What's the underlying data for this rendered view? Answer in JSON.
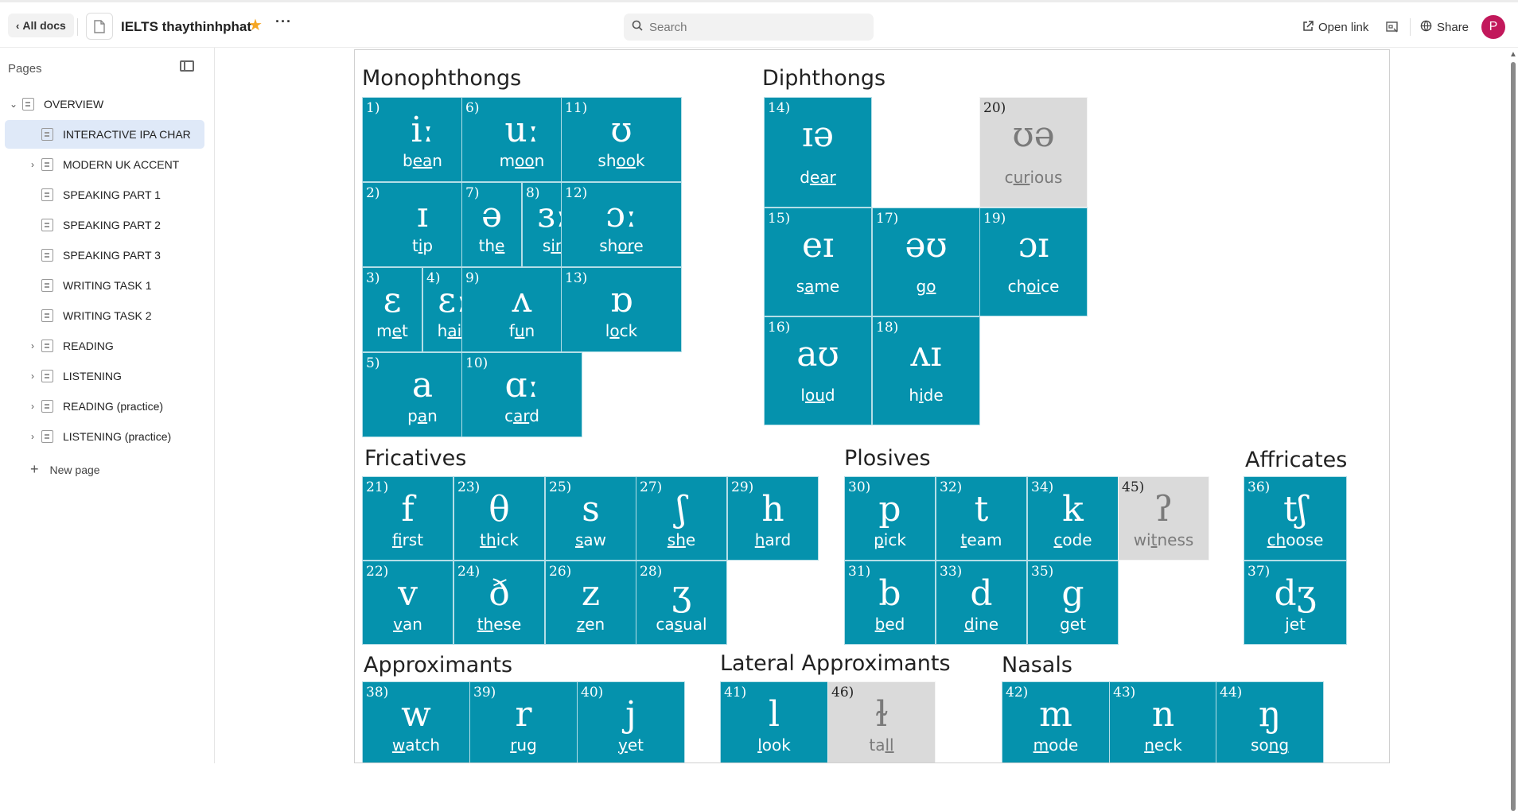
{
  "topbar": {
    "all_docs": "All docs",
    "doc_title": "IELTS thaythinhphat",
    "search_placeholder": "Search",
    "open_link": "Open link",
    "share": "Share",
    "avatar_letter": "P"
  },
  "sidebar": {
    "pages_label": "Pages",
    "items": [
      {
        "label": "OVERVIEW",
        "expand": "v",
        "indent": 0
      },
      {
        "label": "INTERACTIVE IPA CHAR",
        "expand": "",
        "indent": 1,
        "selected": true
      },
      {
        "label": "MODERN UK ACCENT",
        "expand": ">",
        "indent": 1
      },
      {
        "label": "SPEAKING PART 1",
        "expand": "",
        "indent": 1
      },
      {
        "label": "SPEAKING PART 2",
        "expand": "",
        "indent": 1
      },
      {
        "label": "SPEAKING PART 3",
        "expand": "",
        "indent": 1
      },
      {
        "label": "WRITING TASK 1",
        "expand": "",
        "indent": 1
      },
      {
        "label": "WRITING TASK 2",
        "expand": "",
        "indent": 1
      },
      {
        "label": "READING",
        "expand": ">",
        "indent": 1
      },
      {
        "label": "LISTENING",
        "expand": ">",
        "indent": 1
      },
      {
        "label": "READING (practice)",
        "expand": ">",
        "indent": 1
      },
      {
        "label": "LISTENING (practice)",
        "expand": ">",
        "indent": 1
      }
    ],
    "new_page": "New page"
  },
  "chart": {
    "sections": {
      "monophthongs": "Monophthongs",
      "diphthongs": "Diphthongs",
      "fricatives": "Fricatives",
      "plosives": "Plosives",
      "affricates": "Affricates",
      "approximants": "Approximants",
      "lateral": "Lateral Approximants",
      "nasals": "Nasals"
    },
    "sounds": [
      {
        "n": "1)",
        "sym": "iː",
        "word": [
          "b",
          "ea",
          "n"
        ]
      },
      {
        "n": "6)",
        "sym": "uː",
        "word": [
          "m",
          "oo",
          "n"
        ]
      },
      {
        "n": "11)",
        "sym": "ʊ",
        "word": [
          "sh",
          "oo",
          "k"
        ]
      },
      {
        "n": "2)",
        "sym": "ɪ",
        "word": [
          "t",
          "i",
          "p"
        ]
      },
      {
        "n": "7)",
        "sym": "ə",
        "word": [
          "th",
          "e",
          ""
        ]
      },
      {
        "n": "8)",
        "sym": "ɜː",
        "word": [
          "s",
          "ir",
          ""
        ]
      },
      {
        "n": "12)",
        "sym": "ɔː",
        "word": [
          "sh",
          "or",
          "e"
        ]
      },
      {
        "n": "3)",
        "sym": "ɛ",
        "word": [
          "m",
          "e",
          "t"
        ]
      },
      {
        "n": "4)",
        "sym": "ɛː",
        "word": [
          "h",
          "air",
          ""
        ]
      },
      {
        "n": "9)",
        "sym": "ʌ",
        "word": [
          "f",
          "u",
          "n"
        ]
      },
      {
        "n": "13)",
        "sym": "ɒ",
        "word": [
          "l",
          "o",
          "ck"
        ]
      },
      {
        "n": "5)",
        "sym": "a",
        "word": [
          "p",
          "a",
          "n"
        ]
      },
      {
        "n": "10)",
        "sym": "ɑː",
        "word": [
          "c",
          "ar",
          "d"
        ]
      },
      {
        "n": "14)",
        "sym": "ɪə",
        "word": [
          "d",
          "ear",
          ""
        ]
      },
      {
        "n": "20)",
        "sym": "ʊə",
        "word": [
          "c",
          "ur",
          "ious"
        ],
        "gray": true
      },
      {
        "n": "15)",
        "sym": "eɪ",
        "word": [
          "s",
          "a",
          "me"
        ]
      },
      {
        "n": "17)",
        "sym": "əʊ",
        "word": [
          "g",
          "o",
          ""
        ]
      },
      {
        "n": "19)",
        "sym": "ɔɪ",
        "word": [
          "ch",
          "oi",
          "ce"
        ]
      },
      {
        "n": "16)",
        "sym": "aʊ",
        "word": [
          "l",
          "ou",
          "d"
        ]
      },
      {
        "n": "18)",
        "sym": "ʌɪ",
        "word": [
          "h",
          "i",
          "de"
        ]
      },
      {
        "n": "21)",
        "sym": "f",
        "word": [
          "",
          "f",
          "irst"
        ]
      },
      {
        "n": "23)",
        "sym": "θ",
        "word": [
          "",
          "th",
          "ick"
        ]
      },
      {
        "n": "25)",
        "sym": "s",
        "word": [
          "",
          "s",
          "aw"
        ]
      },
      {
        "n": "27)",
        "sym": "ʃ",
        "word": [
          "",
          "sh",
          "e"
        ]
      },
      {
        "n": "29)",
        "sym": "h",
        "word": [
          "",
          "h",
          "ard"
        ]
      },
      {
        "n": "22)",
        "sym": "v",
        "word": [
          "",
          "v",
          "an"
        ]
      },
      {
        "n": "24)",
        "sym": "ð",
        "word": [
          "",
          "th",
          "ese"
        ]
      },
      {
        "n": "26)",
        "sym": "z",
        "word": [
          "",
          "z",
          "en"
        ]
      },
      {
        "n": "28)",
        "sym": "ʒ",
        "word": [
          "ca",
          "s",
          "ual"
        ]
      },
      {
        "n": "30)",
        "sym": "p",
        "word": [
          "",
          "p",
          "ick"
        ]
      },
      {
        "n": "32)",
        "sym": "t",
        "word": [
          "",
          "t",
          "eam"
        ]
      },
      {
        "n": "34)",
        "sym": "k",
        "word": [
          "",
          "c",
          "ode"
        ]
      },
      {
        "n": "45)",
        "sym": "ʔ",
        "word": [
          "wi",
          "t",
          "ness"
        ],
        "gray": true
      },
      {
        "n": "31)",
        "sym": "b",
        "word": [
          "",
          "b",
          "ed"
        ]
      },
      {
        "n": "33)",
        "sym": "d",
        "word": [
          "",
          "d",
          "ine"
        ]
      },
      {
        "n": "35)",
        "sym": "g",
        "word": [
          "",
          "g",
          "et"
        ]
      },
      {
        "n": "36)",
        "sym": "tʃ",
        "word": [
          "",
          "ch",
          "oose"
        ]
      },
      {
        "n": "37)",
        "sym": "dʒ",
        "word": [
          "",
          "j",
          "et"
        ]
      },
      {
        "n": "38)",
        "sym": "w",
        "word": [
          "",
          "w",
          "atch"
        ]
      },
      {
        "n": "39)",
        "sym": "r",
        "word": [
          "",
          "r",
          "ug"
        ]
      },
      {
        "n": "40)",
        "sym": "j",
        "word": [
          "",
          "y",
          "et"
        ]
      },
      {
        "n": "41)",
        "sym": "l",
        "word": [
          "",
          "l",
          "ook"
        ]
      },
      {
        "n": "46)",
        "sym": "ɫ",
        "word": [
          "ta",
          "ll",
          ""
        ],
        "gray": true
      },
      {
        "n": "42)",
        "sym": "m",
        "word": [
          "",
          "m",
          "ode"
        ]
      },
      {
        "n": "43)",
        "sym": "n",
        "word": [
          "",
          "n",
          "eck"
        ]
      },
      {
        "n": "44)",
        "sym": "ŋ",
        "word": [
          "so",
          "ng",
          ""
        ]
      }
    ]
  }
}
